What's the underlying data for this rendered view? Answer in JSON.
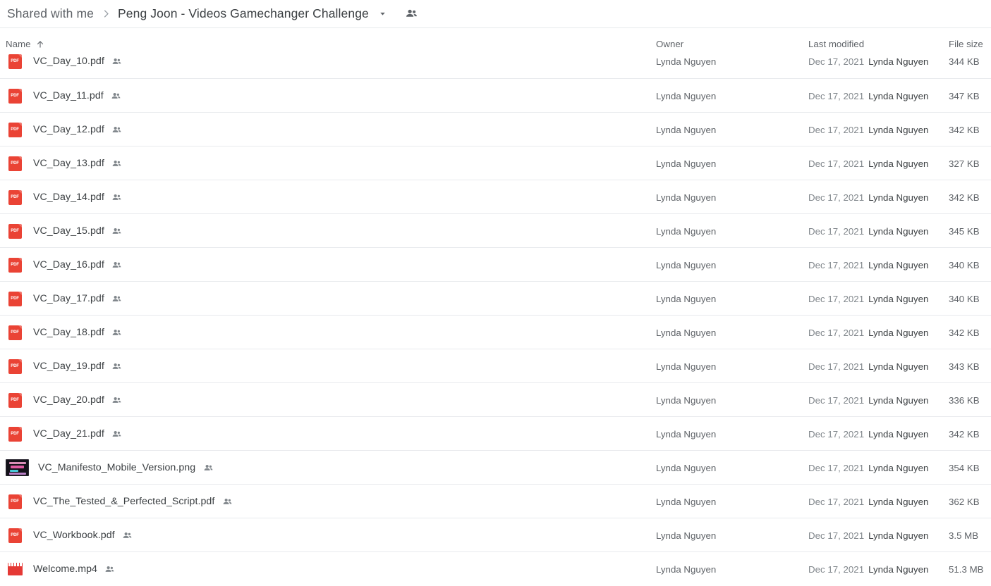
{
  "breadcrumb": {
    "root_label": "Shared with me",
    "separator_icon": "chevron-right-icon",
    "current_label": "Peng Joon - Videos Gamechanger Challenge",
    "caret_icon": "chevron-down-icon",
    "shared_icon": "people-shared-icon"
  },
  "columns": {
    "name": "Name",
    "sort_icon": "arrow-up-icon",
    "owner": "Owner",
    "last_modified": "Last modified",
    "file_size": "File size"
  },
  "colors": {
    "pdf_red": "#ea4335",
    "video_red": "#e53935",
    "text_primary": "#3c4043",
    "text_secondary": "#5f6368",
    "text_muted": "#80868b",
    "divider": "#e8eaed",
    "background": "#ffffff"
  },
  "files": [
    {
      "name": "VC_Day_10.pdf",
      "icon": "pdf-icon",
      "shared": true,
      "owner": "Lynda Nguyen",
      "modified_date": "Dec 17, 2021",
      "modified_by": "Lynda Nguyen",
      "size": "344 KB",
      "clipped_top": true
    },
    {
      "name": "VC_Day_11.pdf",
      "icon": "pdf-icon",
      "shared": true,
      "owner": "Lynda Nguyen",
      "modified_date": "Dec 17, 2021",
      "modified_by": "Lynda Nguyen",
      "size": "347 KB"
    },
    {
      "name": "VC_Day_12.pdf",
      "icon": "pdf-icon",
      "shared": true,
      "owner": "Lynda Nguyen",
      "modified_date": "Dec 17, 2021",
      "modified_by": "Lynda Nguyen",
      "size": "342 KB"
    },
    {
      "name": "VC_Day_13.pdf",
      "icon": "pdf-icon",
      "shared": true,
      "owner": "Lynda Nguyen",
      "modified_date": "Dec 17, 2021",
      "modified_by": "Lynda Nguyen",
      "size": "327 KB"
    },
    {
      "name": "VC_Day_14.pdf",
      "icon": "pdf-icon",
      "shared": true,
      "owner": "Lynda Nguyen",
      "modified_date": "Dec 17, 2021",
      "modified_by": "Lynda Nguyen",
      "size": "342 KB"
    },
    {
      "name": "VC_Day_15.pdf",
      "icon": "pdf-icon",
      "shared": true,
      "owner": "Lynda Nguyen",
      "modified_date": "Dec 17, 2021",
      "modified_by": "Lynda Nguyen",
      "size": "345 KB"
    },
    {
      "name": "VC_Day_16.pdf",
      "icon": "pdf-icon",
      "shared": true,
      "owner": "Lynda Nguyen",
      "modified_date": "Dec 17, 2021",
      "modified_by": "Lynda Nguyen",
      "size": "340 KB"
    },
    {
      "name": "VC_Day_17.pdf",
      "icon": "pdf-icon",
      "shared": true,
      "owner": "Lynda Nguyen",
      "modified_date": "Dec 17, 2021",
      "modified_by": "Lynda Nguyen",
      "size": "340 KB"
    },
    {
      "name": "VC_Day_18.pdf",
      "icon": "pdf-icon",
      "shared": true,
      "owner": "Lynda Nguyen",
      "modified_date": "Dec 17, 2021",
      "modified_by": "Lynda Nguyen",
      "size": "342 KB"
    },
    {
      "name": "VC_Day_19.pdf",
      "icon": "pdf-icon",
      "shared": true,
      "owner": "Lynda Nguyen",
      "modified_date": "Dec 17, 2021",
      "modified_by": "Lynda Nguyen",
      "size": "343 KB"
    },
    {
      "name": "VC_Day_20.pdf",
      "icon": "pdf-icon",
      "shared": true,
      "owner": "Lynda Nguyen",
      "modified_date": "Dec 17, 2021",
      "modified_by": "Lynda Nguyen",
      "size": "336 KB"
    },
    {
      "name": "VC_Day_21.pdf",
      "icon": "pdf-icon",
      "shared": true,
      "owner": "Lynda Nguyen",
      "modified_date": "Dec 17, 2021",
      "modified_by": "Lynda Nguyen",
      "size": "342 KB"
    },
    {
      "name": "VC_Manifesto_Mobile_Version.png",
      "icon": "image-thumbnail-icon",
      "shared": true,
      "owner": "Lynda Nguyen",
      "modified_date": "Dec 17, 2021",
      "modified_by": "Lynda Nguyen",
      "size": "354 KB"
    },
    {
      "name": "VC_The_Tested_&_Perfected_Script.pdf",
      "icon": "pdf-icon",
      "shared": true,
      "owner": "Lynda Nguyen",
      "modified_date": "Dec 17, 2021",
      "modified_by": "Lynda Nguyen",
      "size": "362 KB"
    },
    {
      "name": "VC_Workbook.pdf",
      "icon": "pdf-icon",
      "shared": true,
      "owner": "Lynda Nguyen",
      "modified_date": "Dec 17, 2021",
      "modified_by": "Lynda Nguyen",
      "size": "3.5 MB"
    },
    {
      "name": "Welcome.mp4",
      "icon": "video-icon",
      "shared": true,
      "owner": "Lynda Nguyen",
      "modified_date": "Dec 17, 2021",
      "modified_by": "Lynda Nguyen",
      "size": "51.3 MB"
    }
  ]
}
